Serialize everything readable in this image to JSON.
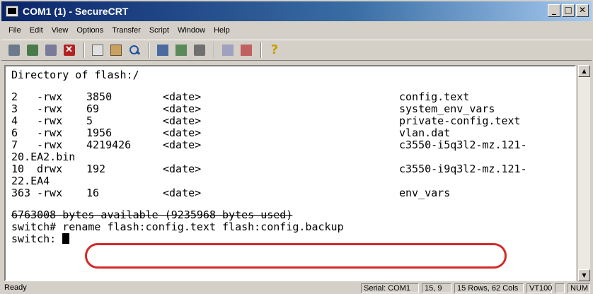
{
  "window": {
    "title": "COM1 (1) - SecureCRT"
  },
  "window_buttons": {
    "minimize": "_",
    "maximize": "□",
    "close": "✕"
  },
  "menu": [
    "File",
    "Edit",
    "View",
    "Options",
    "Transfer",
    "Script",
    "Window",
    "Help"
  ],
  "toolbar": {
    "icons": [
      "connect-icon",
      "quick-connect-icon",
      "reconnect-icon",
      "disconnect-icon",
      "copy-icon",
      "paste-icon",
      "find-icon",
      "log-session-icon",
      "raw-log-icon",
      "print-icon",
      "session-options-icon",
      "keymap-icon",
      "help-icon"
    ],
    "help_glyph": "?"
  },
  "terminal": {
    "header": "Directory of flash:/",
    "entries": [
      {
        "num": "2",
        "perm": "-rwx",
        "size": "3850",
        "date": "<date>",
        "name": "config.text"
      },
      {
        "num": "3",
        "perm": "-rwx",
        "size": "69",
        "date": "<date>",
        "name": "system_env_vars"
      },
      {
        "num": "4",
        "perm": "-rwx",
        "size": "5",
        "date": "<date>",
        "name": "private-config.text"
      },
      {
        "num": "6",
        "perm": "-rwx",
        "size": "1956",
        "date": "<date>",
        "name": "vlan.dat"
      },
      {
        "num": "7",
        "perm": "-rwx",
        "size": "4219426",
        "date": "<date>",
        "name": "c3550-i5q3l2-mz.121-"
      },
      {
        "num": "10",
        "perm": "drwx",
        "size": "192",
        "date": "<date>",
        "name": "c3550-i9q3l2-mz.121-"
      },
      {
        "num": "363",
        "perm": "-rwx",
        "size": "16",
        "date": "<date>",
        "name": "env_vars"
      }
    ],
    "wrap1": "20.EA2.bin",
    "wrap2": "22.EA4",
    "summary": "6763008 bytes available (9235968 bytes used)",
    "command_prompt": "switch#",
    "command": " rename flash:config.text flash:config.backup",
    "prompt2": "switch:"
  },
  "status": {
    "ready": "Ready",
    "serial": "Serial: COM1",
    "pos": "15,  9",
    "size": "15 Rows,  62 Cols",
    "emulation": "VT100",
    "blank": "",
    "num": "NUM"
  },
  "colors": {
    "annotation": "#d32a2a",
    "titlebar_start": "#0a246a",
    "titlebar_end": "#a6caf0"
  }
}
